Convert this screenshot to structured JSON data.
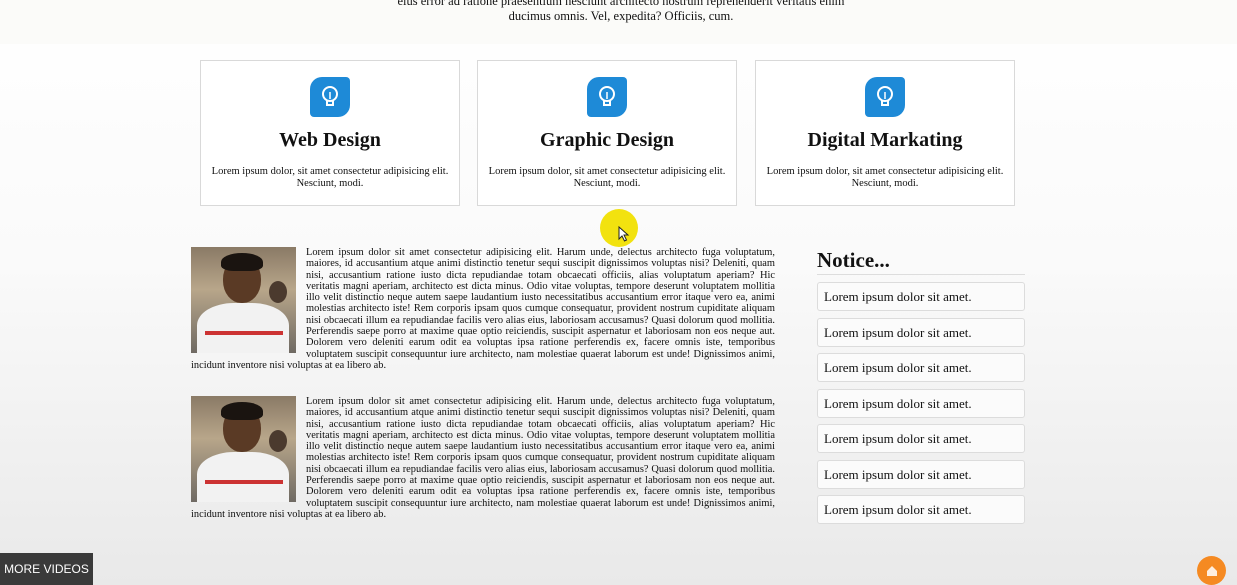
{
  "intro": {
    "text": "eius error ad ratione praesentium nesciunt architecto nostrum reprehenderit veritatis enim ducimus omnis. Vel, expedita? Officiis, cum."
  },
  "services": [
    {
      "icon": "lightbulb-icon",
      "title": "Web Design",
      "text": "Lorem ipsum dolor, sit amet consectetur adipisicing elit. Nesciunt, modi."
    },
    {
      "icon": "lightbulb-icon",
      "title": "Graphic Design",
      "text": "Lorem ipsum dolor, sit amet consectetur adipisicing elit. Nesciunt, modi."
    },
    {
      "icon": "lightbulb-icon",
      "title": "Digital Markating",
      "text": "Lorem ipsum dolor, sit amet consectetur adipisicing elit. Nesciunt, modi."
    }
  ],
  "articles": [
    {
      "text": "Lorem ipsum dolor sit amet consectetur adipisicing elit. Harum unde, delectus architecto fuga voluptatum, maiores, id accusantium atque animi distinctio tenetur sequi suscipit dignissimos voluptas nisi? Deleniti, quam nisi, accusantium ratione iusto dicta repudiandae totam obcaecati officiis, alias voluptatum aperiam? Hic veritatis magni aperiam, architecto est dicta minus. Odio vitae voluptas, tempore deserunt voluptatem mollitia illo velit distinctio neque autem saepe laudantium iusto necessitatibus accusantium error itaque vero ea, animi molestias architecto iste! Rem corporis ipsam quos cumque consequatur, provident nostrum cupiditate aliquam nisi obcaecati illum ea repudiandae facilis vero alias eius, laboriosam accusamus? Quasi dolorum quod mollitia. Perferendis saepe porro at maxime quae optio reiciendis, suscipit aspernatur et laboriosam non eos neque aut. Dolorem vero deleniti earum odit ea voluptas ipsa ratione perferendis ex, facere omnis iste, temporibus voluptatem suscipit consequuntur iure architecto, nam molestiae quaerat laborum est unde! Dignissimos animi, incidunt inventore nisi voluptas at ea libero ab."
    },
    {
      "text": "Lorem ipsum dolor sit amet consectetur adipisicing elit. Harum unde, delectus architecto fuga voluptatum, maiores, id accusantium atque animi distinctio tenetur sequi suscipit dignissimos voluptas nisi? Deleniti, quam nisi, accusantium ratione iusto dicta repudiandae totam obcaecati officiis, alias voluptatum aperiam? Hic veritatis magni aperiam, architecto est dicta minus. Odio vitae voluptas, tempore deserunt voluptatem mollitia illo velit distinctio neque autem saepe laudantium iusto necessitatibus accusantium error itaque vero ea, animi molestias architecto iste! Rem corporis ipsam quos cumque consequatur, provident nostrum cupiditate aliquam nisi obcaecati illum ea repudiandae facilis vero alias eius, laboriosam accusamus? Quasi dolorum quod mollitia. Perferendis saepe porro at maxime quae optio reiciendis, suscipit aspernatur et laboriosam non eos neque aut. Dolorem vero deleniti earum odit ea voluptas ipsa ratione perferendis ex, facere omnis iste, temporibus voluptatem suscipit consequuntur iure architecto, nam molestiae quaerat laborum est unde! Dignissimos animi, incidunt inventore nisi voluptas at ea libero ab."
    }
  ],
  "notice": {
    "title": "Notice...",
    "items": [
      "Lorem ipsum dolor sit amet.",
      "Lorem ipsum dolor sit amet.",
      "Lorem ipsum dolor sit amet.",
      "Lorem ipsum dolor sit amet.",
      "Lorem ipsum dolor sit amet.",
      "Lorem ipsum dolor sit amet.",
      "Lorem ipsum dolor sit amet."
    ]
  },
  "overlay": {
    "more_videos_label": "MORE VIDEOS"
  },
  "colors": {
    "icon_blue": "#1e8ad7",
    "cursor_highlight": "#f2e20f",
    "badge_orange": "#f58a22"
  }
}
